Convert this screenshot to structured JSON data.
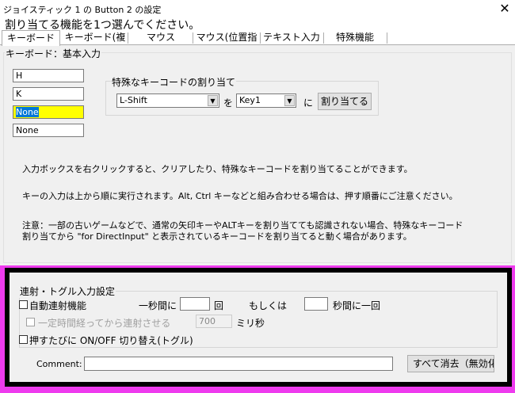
{
  "window": {
    "title": "ジョイスティック 1 の Button 2 の設定",
    "close_glyph": "✕"
  },
  "instruction": "割り当てる機能を1つ選んでください。",
  "tabs": [
    {
      "label": "キーボード",
      "active": true
    },
    {
      "label": "キーボード(複",
      "active": false
    },
    {
      "label": "マウス",
      "active": false
    },
    {
      "label": "マウス(位置指",
      "active": false
    },
    {
      "label": "テキスト入力",
      "active": false
    },
    {
      "label": "特殊機能",
      "active": false
    }
  ],
  "keyboard_group": {
    "title": "キーボード：基本入力",
    "inputs": [
      {
        "value": "H",
        "highlight": false
      },
      {
        "value": "K",
        "highlight": false
      },
      {
        "value": "None",
        "highlight": true
      },
      {
        "value": "None",
        "highlight": false
      }
    ]
  },
  "special_key": {
    "title": "特殊なキーコードの割り当て",
    "key_select": "L-Shift",
    "connector_wo": "を",
    "target_select": "Key1",
    "connector_ni": "に",
    "assign_button": "割り当てる"
  },
  "info_texts": {
    "line1": "入力ボックスを右クリックすると、クリアしたり、特殊なキーコードを割り当てることができます。",
    "line2": "キーの入力は上から順に実行されます。Alt, Ctrl キーなどと組み合わせる場合は、押す順番にご注意ください。",
    "note1": "注意：一部の古いゲームなどで、通常の矢印キーやALTキーを割り当てても認識されない場合、特殊なキーコード",
    "note2": "割り当てから \"for DirectInput\" と表示されているキーコードを割り当てると動く場合があります。"
  },
  "rapid_fire": {
    "title": "連射・トグル入力設定",
    "auto_fire_label": "自動連射機能",
    "per_second_prefix": "一秒間に",
    "per_second_value": "",
    "per_second_unit": "回",
    "or_label": "もしくは",
    "interval_value": "",
    "interval_unit": "秒間に一回",
    "delay_label": "一定時間経ってから連射させる",
    "delay_value": "700",
    "delay_unit": "ミリ秒",
    "toggle_label": "押すたびに ON/OFF 切り替え(トグル)",
    "comment_label": "Comment:",
    "comment_value": "",
    "clear_button": "すべて消去（無効化"
  },
  "colors": {
    "highlight_field": "#ffff00",
    "selection": "#0078d7",
    "annotation_magenta": "#ee3bee",
    "annotation_frame": "#000000"
  }
}
